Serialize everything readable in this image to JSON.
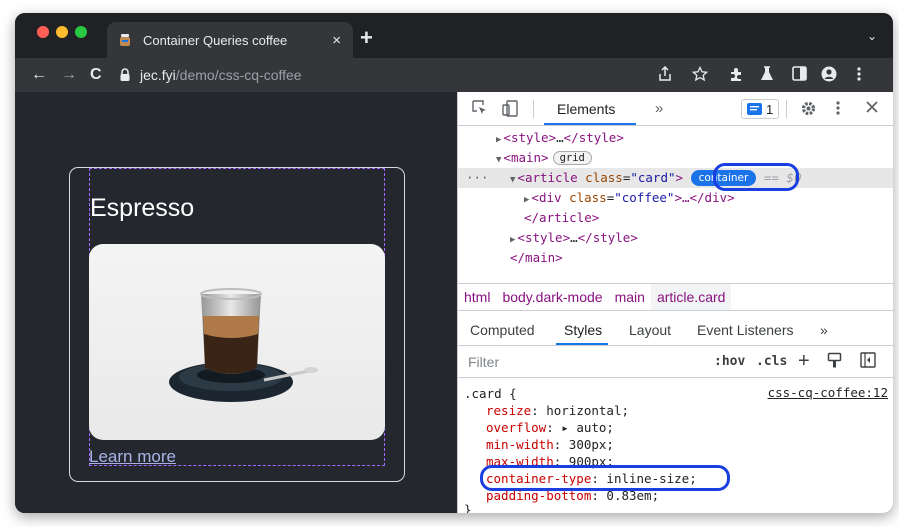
{
  "browser": {
    "tab": {
      "title": "Container Queries coffee",
      "close": "×"
    },
    "new_tab": "+",
    "tab_menu": "⌄",
    "nav": {
      "back": "←",
      "forward": "→",
      "reload": "C"
    },
    "address": {
      "domain": "jec.fyi",
      "path": "/demo/css-cq-coffee"
    },
    "toolbar_icons": [
      "share-icon",
      "star-icon",
      "extensions-icon",
      "lab-icon",
      "sidepanel-icon",
      "profile-icon",
      "kebab-menu-icon"
    ]
  },
  "page": {
    "card_title": "Espresso",
    "link": "Learn more"
  },
  "devtools": {
    "active_tab": "Elements",
    "more_tabs": "»",
    "issues_count": "1",
    "dom": {
      "style_open_1": "<style>",
      "ellipsis_1": "…",
      "style_close_1": "</style>",
      "main_open": "<main>",
      "grid_badge": "grid",
      "article_open": "<article",
      "article_attr": "class",
      "article_val": "\"card\"",
      "article_gt": ">",
      "container_badge": "container",
      "selected_marker": "== $0",
      "row_ellipsis": "···",
      "div_open": "<div",
      "div_attr": "class",
      "div_val": "\"coffee\"",
      "div_rest": ">…</div>",
      "article_close": "</article>",
      "style_open_2": "<style>",
      "ellipsis_2": "…",
      "style_close_2": "</style>",
      "main_close": "</main>"
    },
    "breadcrumbs": [
      "html",
      "body.dark-mode",
      "main",
      "article.card"
    ],
    "subtabs": [
      "Computed",
      "Styles",
      "Layout",
      "Event Listeners",
      "»"
    ],
    "filter": {
      "placeholder": "Filter",
      "hov": ":hov",
      "cls": ".cls",
      "plus": "+"
    },
    "rule": {
      "selector": ".card {",
      "source": "css-cq-coffee:12",
      "declarations": [
        {
          "prop": "resize",
          "value": "horizontal;"
        },
        {
          "prop": "overflow",
          "value": "▸ auto;"
        },
        {
          "prop": "min-width",
          "value": "300px;"
        },
        {
          "prop": "max-width",
          "value": "900px;"
        },
        {
          "prop": "container-type",
          "value": "inline-size;"
        },
        {
          "prop": "padding-bottom",
          "value": "0.83em;"
        }
      ],
      "close": "}"
    }
  },
  "colors": {
    "accent": "#1a73e8",
    "highlight_ring": "#1a3fe0",
    "page_bg": "#25272e",
    "tag": "#881280",
    "css_prop": "#c80000"
  }
}
